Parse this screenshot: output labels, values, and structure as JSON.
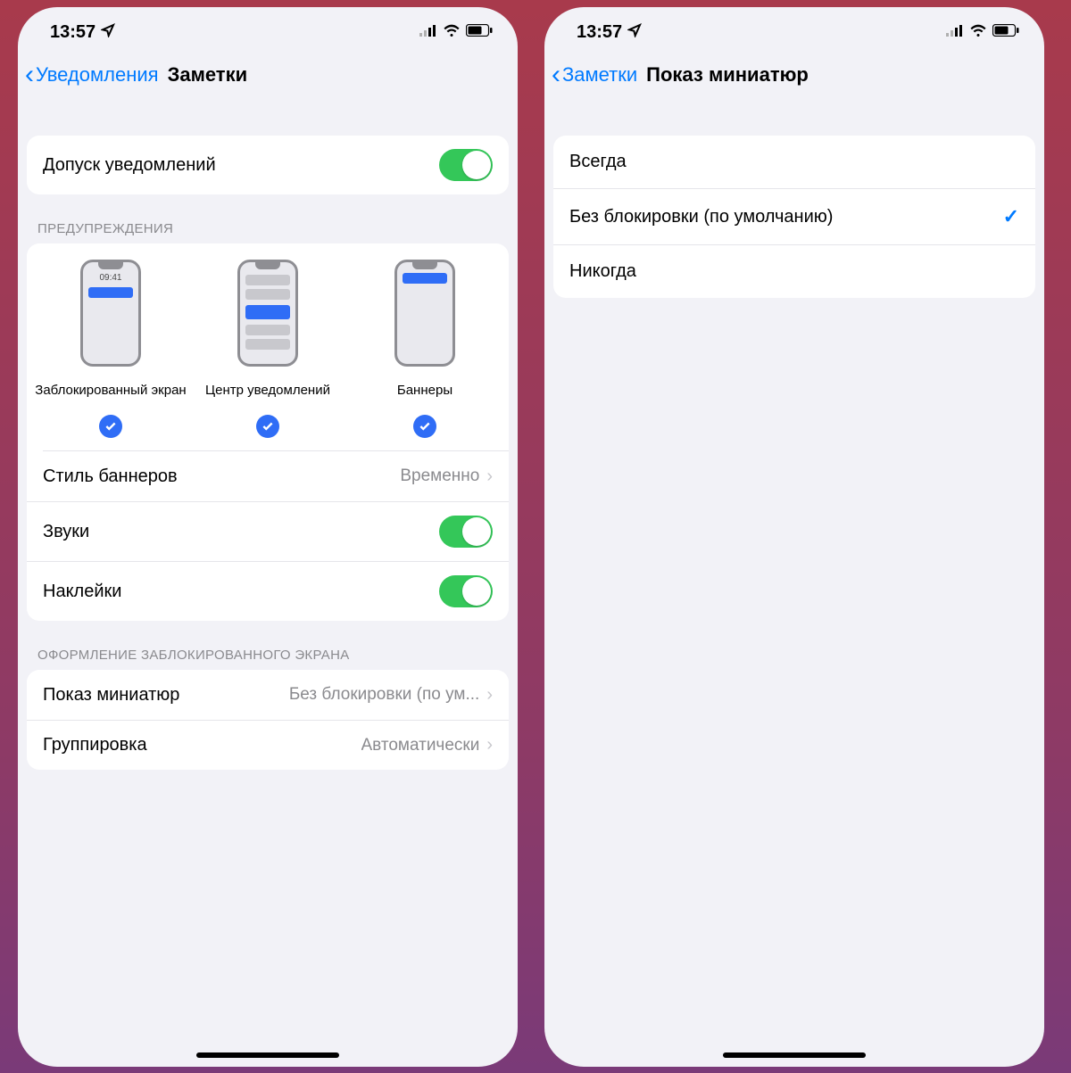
{
  "status": {
    "time": "13:57"
  },
  "left": {
    "back_label": "Уведомления",
    "title": "Заметки",
    "allow_label": "Допуск уведомлений",
    "alerts_header": "ПРЕДУПРЕЖДЕНИЯ",
    "alerts": {
      "lock_time": "09:41",
      "lock_label": "Заблокированный экран",
      "center_label": "Центр уведомлений",
      "banners_label": "Баннеры"
    },
    "banner_style_label": "Стиль баннеров",
    "banner_style_value": "Временно",
    "sounds_label": "Звуки",
    "badges_label": "Наклейки",
    "lockscreen_header": "ОФОРМЛЕНИЕ ЗАБЛОКИРОВАННОГО ЭКРАНА",
    "previews_label": "Показ миниатюр",
    "previews_value": "Без блокировки (по ум...",
    "grouping_label": "Группировка",
    "grouping_value": "Автоматически"
  },
  "right": {
    "back_label": "Заметки",
    "title": "Показ миниатюр",
    "options": {
      "always": "Всегда",
      "unlocked": "Без блокировки (по умолчанию)",
      "never": "Никогда"
    }
  }
}
